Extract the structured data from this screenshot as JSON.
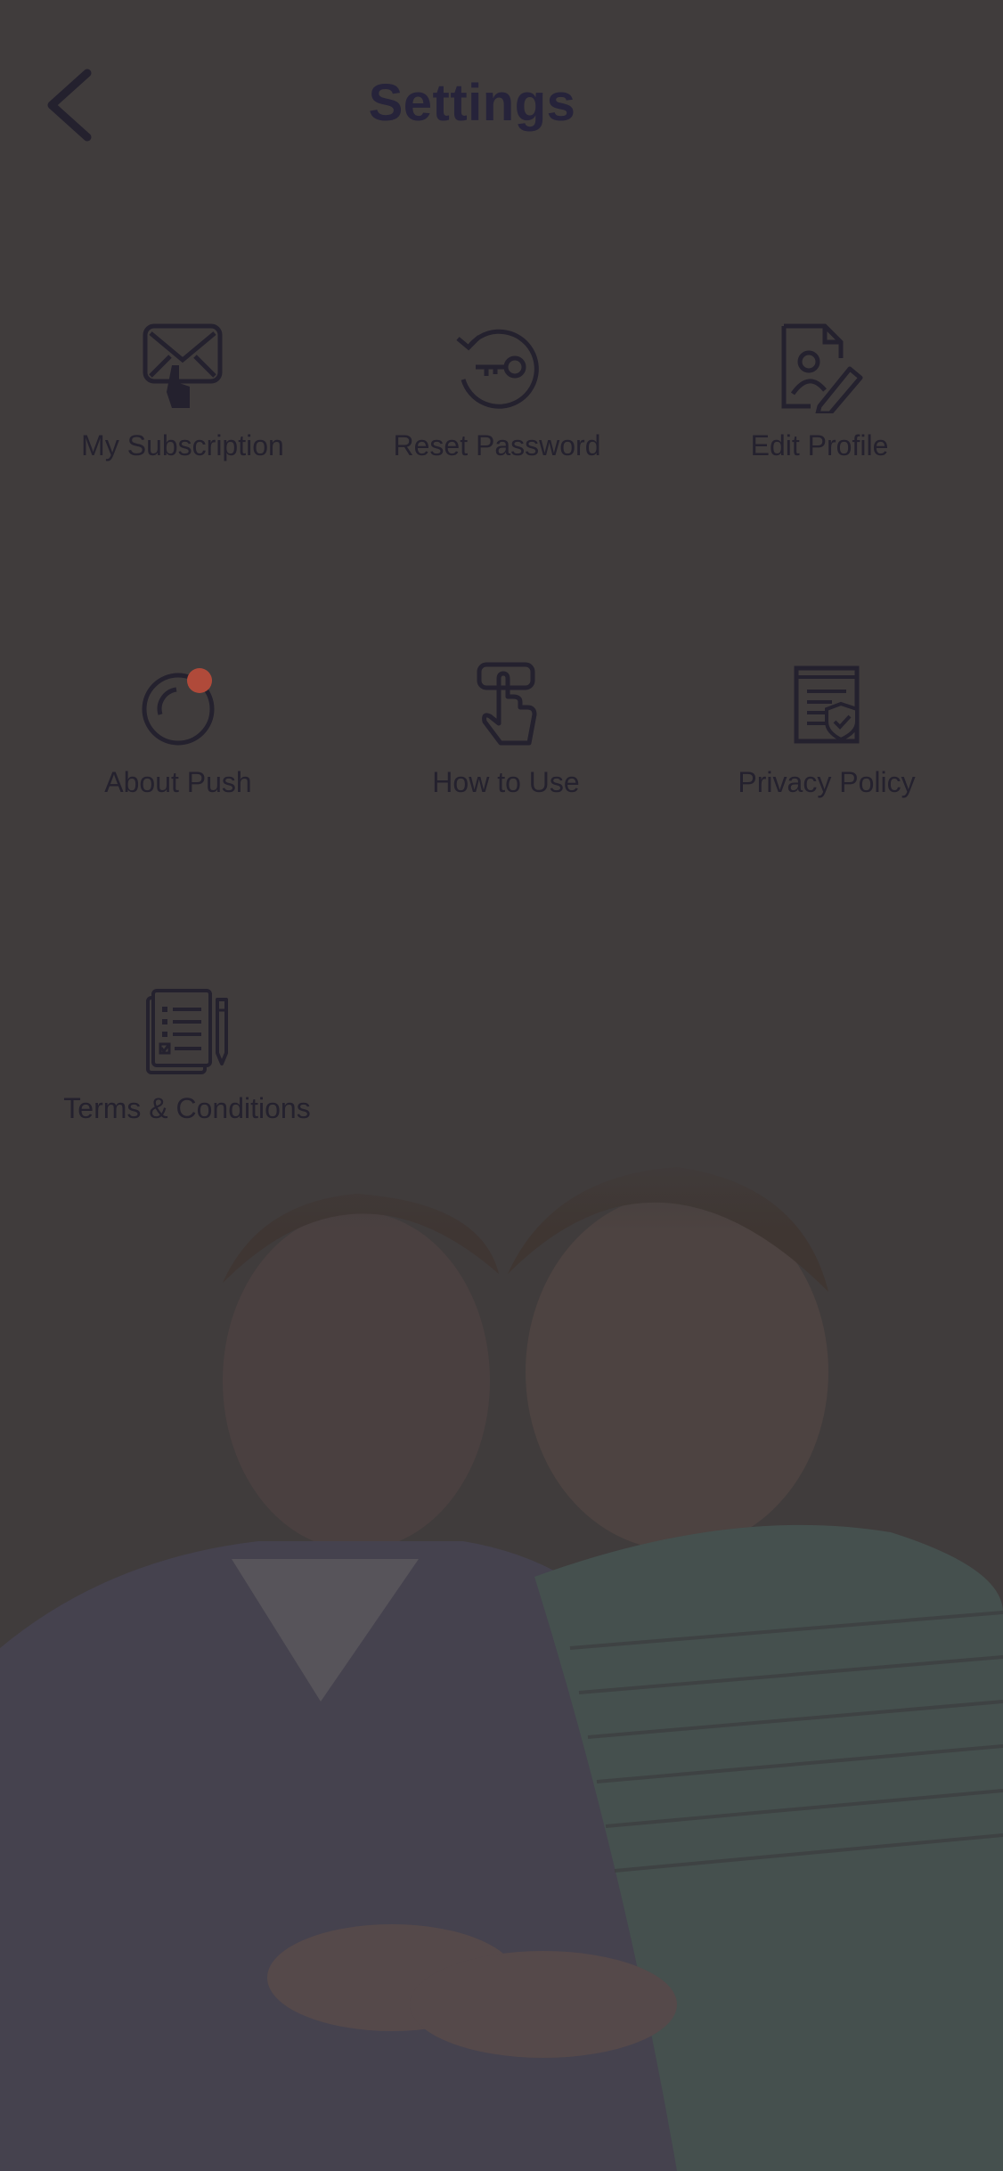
{
  "header": {
    "title": "Settings",
    "back_icon": "chevron-left-icon"
  },
  "settings": {
    "items": [
      {
        "label": "My Subscription",
        "icon": "subscription-envelope-icon"
      },
      {
        "label": "Reset Password",
        "icon": "reset-password-key-icon"
      },
      {
        "label": "Edit Profile",
        "icon": "edit-profile-document-icon"
      },
      {
        "label": "About Push",
        "icon": "about-push-notification-icon"
      },
      {
        "label": "How to Use",
        "icon": "tap-gesture-icon"
      },
      {
        "label": "Privacy Policy",
        "icon": "privacy-shield-document-icon"
      },
      {
        "label": "Terms & Conditions",
        "icon": "terms-checklist-pen-icon"
      }
    ]
  },
  "colors": {
    "overlay_background": "#403c3c",
    "icon_stroke": "#24212e",
    "text": "#24212e",
    "notification_dot": "#b04a3a"
  },
  "background_image": "two-men-looking-at-phone-photo"
}
